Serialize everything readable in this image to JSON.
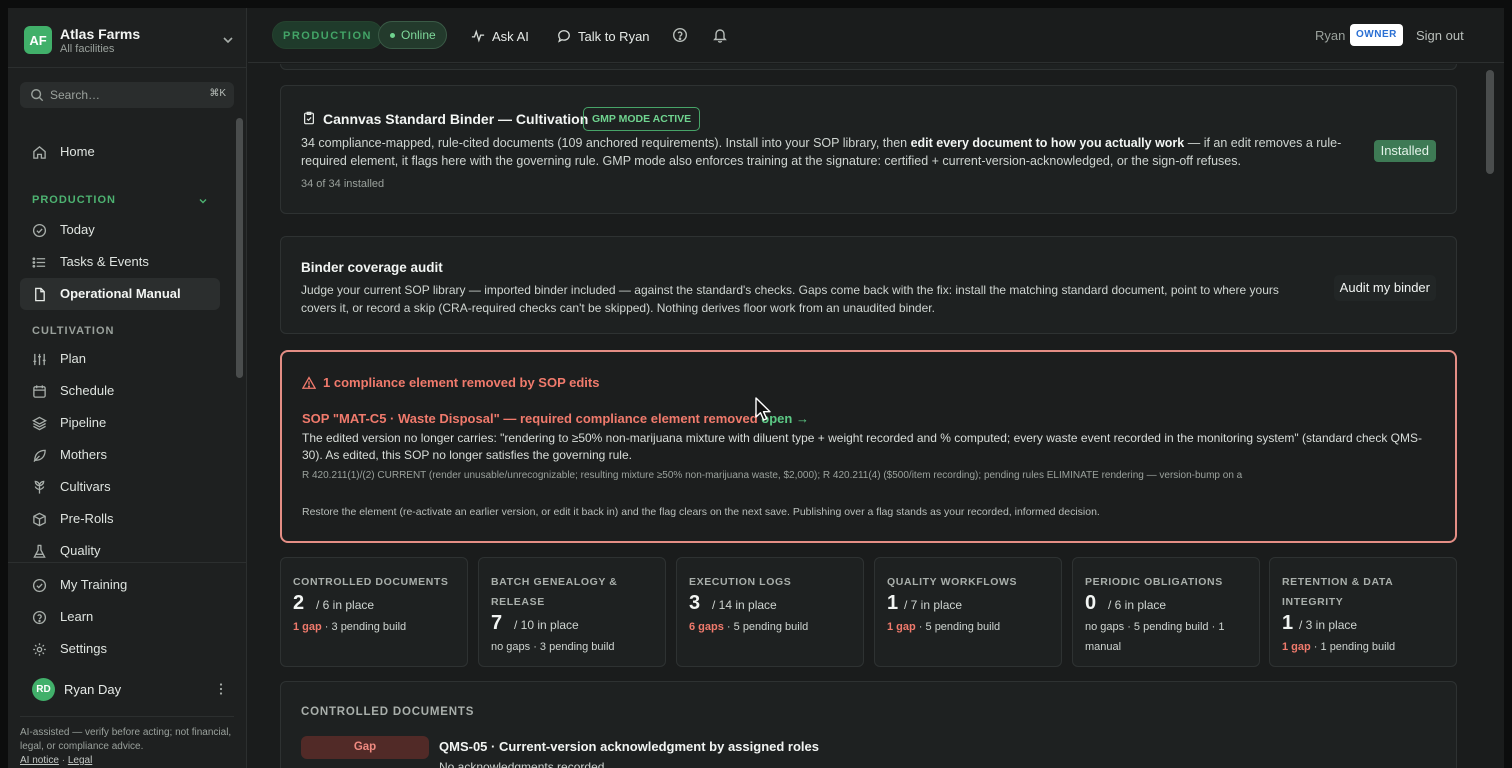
{
  "org": {
    "badge": "AF",
    "name": "Atlas Farms",
    "sub": "All facilities"
  },
  "search": {
    "placeholder": "Search…",
    "shortcut": "⌘K"
  },
  "nav": {
    "home": "Home",
    "production_section": "PRODUCTION",
    "today": "Today",
    "tasks": "Tasks & Events",
    "manual": "Operational Manual",
    "cultivation_section": "CULTIVATION",
    "plan": "Plan",
    "schedule": "Schedule",
    "pipeline": "Pipeline",
    "mothers": "Mothers",
    "cultivars": "Cultivars",
    "prerolls": "Pre-Rolls",
    "quality": "Quality"
  },
  "bottom_nav": {
    "training": "My Training",
    "learn": "Learn",
    "settings": "Settings"
  },
  "user": {
    "initials": "RD",
    "name": "Ryan Day"
  },
  "disclaimer": {
    "text": "AI-assisted — verify before acting; not financial, legal, or compliance advice.",
    "ai_notice": "AI notice",
    "separator": "·",
    "legal": "Legal"
  },
  "topbar": {
    "env": "PRODUCTION",
    "status": "Online",
    "ask_ai": "Ask AI",
    "talk": "Talk to Ryan",
    "user": "Ryan",
    "role": "OWNER",
    "signout": "Sign out"
  },
  "binder": {
    "title": "Cannvas Standard Binder — Cultivation",
    "badge": "GMP MODE ACTIVE",
    "text_a": "34 compliance-mapped, rule-cited documents (109 anchored requirements). Install into your SOP library, then ",
    "text_bold": "edit every document to how you actually work",
    "text_b": " — if an edit removes a rule-required element, it flags here with the governing rule. GMP mode also enforces training at the signature: certified + current-version-acknowledged, or the sign-off refuses.",
    "count": "34 of 34 installed",
    "status": "Installed"
  },
  "audit": {
    "title": "Binder coverage audit",
    "text": "Judge your current SOP library — imported binder included — against the standard's checks. Gaps come back with the fix: install the matching standard document, point to where yours covers it, or record a skip (CRA-required checks can't be skipped). Nothing derives floor work from an unaudited binder.",
    "button": "Audit my binder"
  },
  "alert": {
    "title": "1 compliance element removed by SOP edits",
    "link": "SOP \"MAT-C5 · Waste Disposal\" — required compliance element removed",
    "open": "open →",
    "text": "The edited version no longer carries: \"rendering to ≥50% non-marijuana mixture with diluent type + weight recorded and % computed; every waste event recorded in the monitoring system\" (standard check QMS-30). As edited, this SOP no longer satisfies the governing rule.",
    "rule": "R 420.211(1)/(2) CURRENT (render unusable/unrecognizable; resulting mixture ≥50% non-marijuana waste, $2,000); R 420.211(4) ($500/item recording); pending rules ELIMINATE rendering — version-bump on a",
    "note": "Restore the element (re-activate an earlier version, or edit it back in) and the flag clears on the next save. Publishing over a flag stands as your recorded, informed decision."
  },
  "stats": [
    {
      "title": "CONTROLLED DOCUMENTS",
      "num": "2",
      "of": "/ 6 in place",
      "gap": "1 gap",
      "rest": "· 3 pending build"
    },
    {
      "title": "BATCH GENEALOGY & RELEASE",
      "num": "7",
      "of": "/ 10 in place",
      "gap": "",
      "rest": "no gaps · 3 pending build"
    },
    {
      "title": "EXECUTION LOGS",
      "num": "3",
      "of": "/ 14 in place",
      "gap": "6 gaps",
      "rest": "· 5 pending build"
    },
    {
      "title": "QUALITY WORKFLOWS",
      "num": "1",
      "of": "/ 7 in place",
      "gap": "1 gap",
      "rest": "· 5 pending build"
    },
    {
      "title": "PERIODIC OBLIGATIONS",
      "num": "0",
      "of": "/ 6 in place",
      "gap": "",
      "rest": "no gaps · 5 pending build · 1 manual"
    },
    {
      "title": "RETENTION & DATA INTEGRITY",
      "num": "1",
      "of": "/ 3 in place",
      "gap": "1 gap",
      "rest": "· 1 pending build"
    }
  ],
  "list": {
    "heading": "CONTROLLED DOCUMENTS",
    "pill": "Gap",
    "title": "QMS-05 · Current-version acknowledgment by assigned roles",
    "sub": "No acknowledgments recorded"
  },
  "colors": {
    "accent": "#41b06a",
    "alert": "#e48e85",
    "gap": "#f07a6c",
    "background": "#1a1c1c"
  }
}
